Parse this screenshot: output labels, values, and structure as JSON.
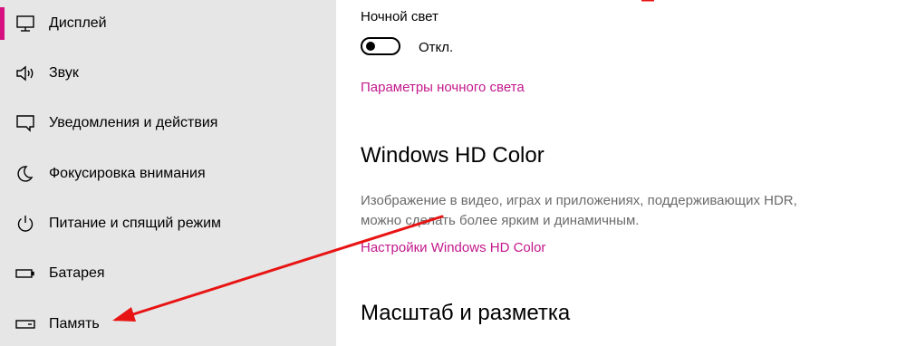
{
  "sidebar": {
    "items": [
      {
        "label": "Дисплей",
        "icon": "monitor-icon",
        "selected": true
      },
      {
        "label": "Звук",
        "icon": "speaker-icon",
        "selected": false
      },
      {
        "label": "Уведомления и действия",
        "icon": "notification-icon",
        "selected": false
      },
      {
        "label": "Фокусировка внимания",
        "icon": "moon-icon",
        "selected": false
      },
      {
        "label": "Питание и спящий режим",
        "icon": "power-icon",
        "selected": false
      },
      {
        "label": "Батарея",
        "icon": "battery-icon",
        "selected": false
      },
      {
        "label": "Память",
        "icon": "storage-icon",
        "selected": false
      }
    ],
    "accent_color": "#d6117f"
  },
  "main": {
    "night_light": {
      "title": "Ночной свет",
      "toggle_state": "Откл.",
      "enabled": false,
      "settings_link": "Параметры ночного света"
    },
    "hd_color": {
      "title": "Windows HD Color",
      "description": "Изображение в видео, играх и приложениях, поддерживающих HDR, можно сделать более ярким и динамичным.",
      "settings_link": "Настройки Windows HD Color"
    },
    "scale": {
      "title": "Масштаб и разметка"
    },
    "link_color": "#c2198c"
  },
  "annotation": {
    "color": "#e81414",
    "points_to": "Память"
  }
}
